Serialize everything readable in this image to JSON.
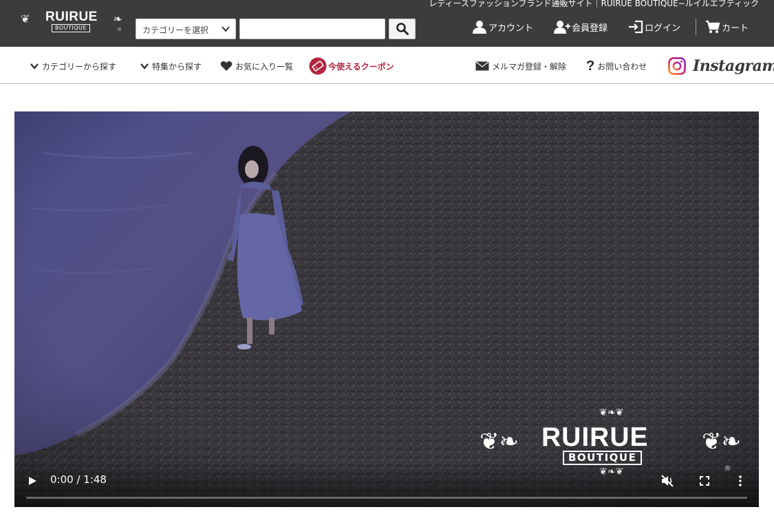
{
  "header": {
    "tagline": "レディースファッションブランド通販サイト｜RUIRUE BOUTIQUE−ルイルエブティック",
    "logo": {
      "name": "RUIRUE",
      "sub": "BOUTIQUE",
      "reg": "®"
    },
    "category_select": {
      "selected": "カテゴリーを選択",
      "icon": "chevron-down-icon"
    },
    "search": {
      "value": "",
      "placeholder": "",
      "icon": "search-icon"
    },
    "nav": {
      "account": "アカウント",
      "register": "会員登録",
      "login": "ログイン",
      "cart": "カート"
    }
  },
  "subnav": {
    "category": "カテゴリーから探す",
    "feature": "特集から探す",
    "favorites": "お気に入り一覧",
    "coupon": "今使えるクーポン",
    "newsletter": "メルマガ登録・解除",
    "contact": "お問い合わせ",
    "instagram": "Instagram"
  },
  "video": {
    "current_time": "0:00",
    "duration": "1:48",
    "time_display": "0:00 / 1:48",
    "progress": 0,
    "muted": true,
    "watermark": {
      "name": "RUIRUE",
      "sub": "BOUTIQUE",
      "reg": "®"
    }
  },
  "colors": {
    "header_bg": "#3c3c3c",
    "coupon_accent": "#b4243e",
    "text_dark": "#333333"
  }
}
